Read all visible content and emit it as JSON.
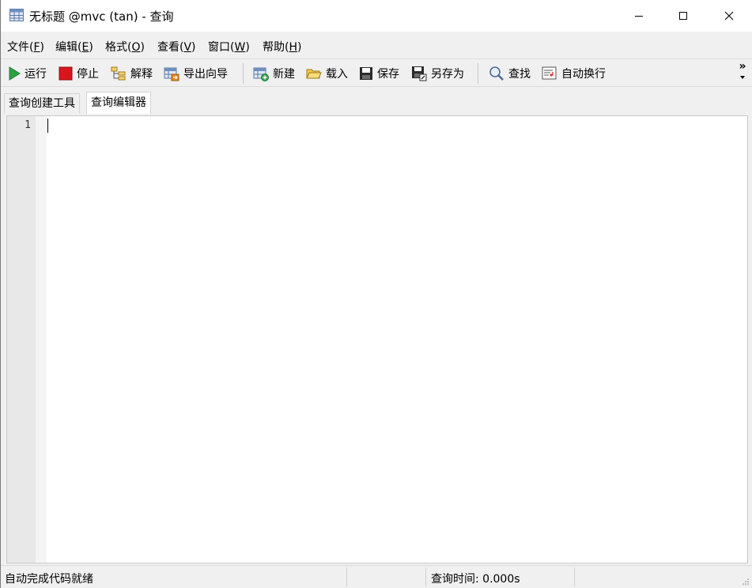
{
  "window": {
    "title": "无标题 @mvc (tan) - 查询",
    "app_icon": "table-grid-icon"
  },
  "menu": {
    "items": [
      {
        "label": "文件(",
        "key": "F",
        "suffix": ")"
      },
      {
        "label": "编辑(",
        "key": "E",
        "suffix": ")"
      },
      {
        "label": "格式(",
        "key": "O",
        "suffix": ")"
      },
      {
        "label": "查看(",
        "key": "V",
        "suffix": ")"
      },
      {
        "label": "窗口(",
        "key": "W",
        "suffix": ")"
      },
      {
        "label": "帮助(",
        "key": "H",
        "suffix": ")"
      }
    ]
  },
  "toolbar": {
    "run": "运行",
    "stop": "停止",
    "explain": "解释",
    "export_wizard": "导出向导",
    "new": "新建",
    "load": "载入",
    "save": "保存",
    "save_as": "另存为",
    "find": "查找",
    "word_wrap": "自动换行",
    "overflow": "»"
  },
  "tabs": [
    {
      "label": "查询创建工具",
      "active": false
    },
    {
      "label": "查询编辑器",
      "active": true
    }
  ],
  "editor": {
    "line_numbers": [
      "1"
    ],
    "content": ""
  },
  "status": {
    "left": "自动完成代码就绪",
    "query_time": "查询时间: 0.000s"
  },
  "colors": {
    "run_green": "#2ea043",
    "stop_red": "#d9161c",
    "background": "#f0f0f0"
  }
}
